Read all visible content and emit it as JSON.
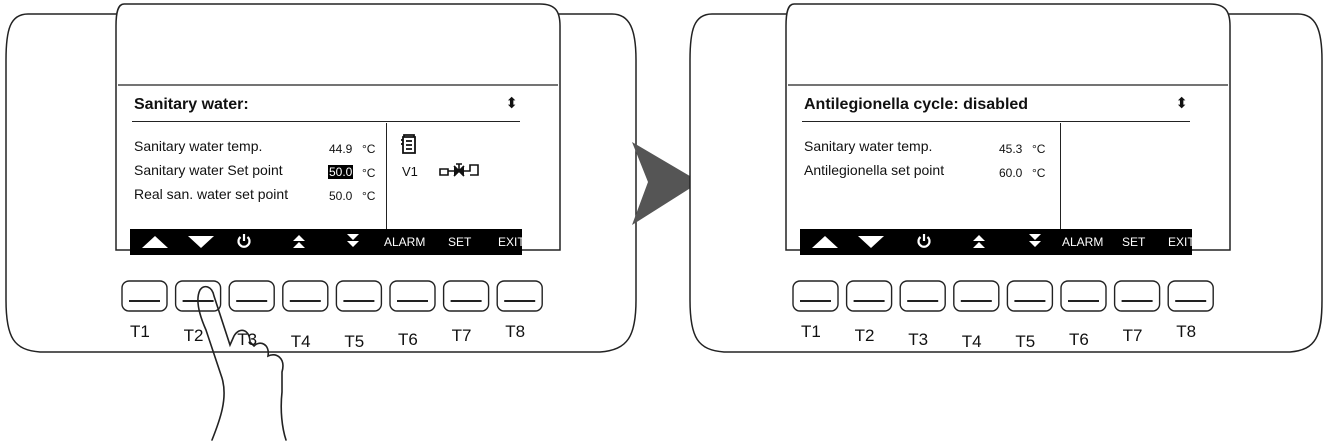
{
  "left_panel": {
    "title": "Sanitary water:",
    "rows": [
      {
        "label": "Sanitary water temp.",
        "value": "44.9",
        "unit": "°C"
      },
      {
        "label": "Sanitary water Set point",
        "value": "50.0",
        "unit": "°C"
      },
      {
        "label": "Real san. water set point",
        "value": "50.0",
        "unit": "°C"
      }
    ],
    "aside_label": "V1",
    "softkeys": {
      "alarm": "ALARM",
      "set": "SET",
      "exit": "EXIT"
    },
    "button_labels": [
      "T1",
      "T2",
      "T3",
      "T4",
      "T5",
      "T6",
      "T7",
      "T8"
    ]
  },
  "right_panel": {
    "title": "Antilegionella cycle: disabled",
    "rows": [
      {
        "label": "Sanitary water temp.",
        "value": "45.3",
        "unit": "°C"
      },
      {
        "label": "Antilegionella set point",
        "value": "60.0",
        "unit": "°C"
      }
    ],
    "softkeys": {
      "alarm": "ALARM",
      "set": "SET",
      "exit": "EXIT"
    },
    "button_labels": [
      "T1",
      "T2",
      "T3",
      "T4",
      "T5",
      "T6",
      "T7",
      "T8"
    ]
  },
  "colors": {
    "lcd_bar": "#000000",
    "arrow": "#555555",
    "outline": "#222222"
  },
  "icons": [
    "up-arrow-icon",
    "down-arrow-icon",
    "power-icon",
    "page-up-icon",
    "page-down-icon",
    "boiler-icon",
    "valve-icon",
    "pointing-hand-icon",
    "transition-arrow-icon"
  ]
}
